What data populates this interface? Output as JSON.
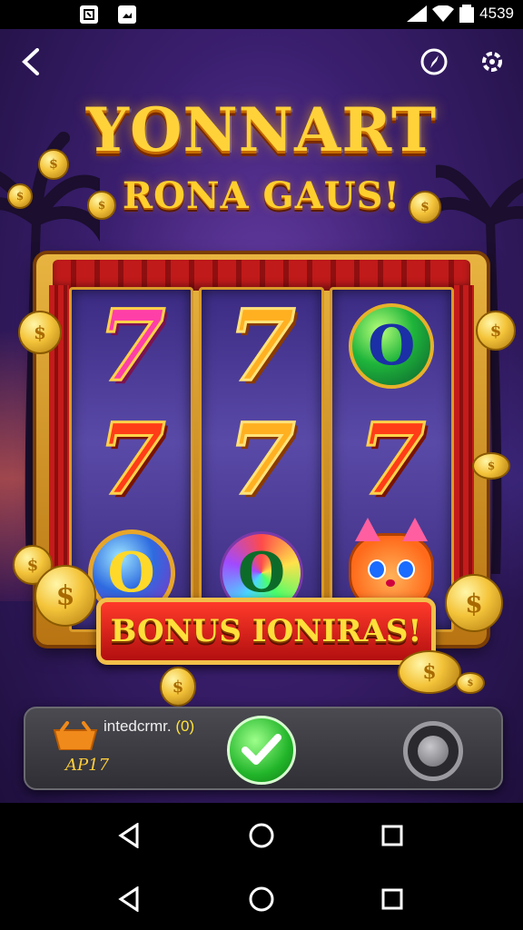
{
  "status_bar": {
    "time": "4539",
    "icons": [
      "notification-icon",
      "image-icon",
      "signal-icon",
      "wifi-icon",
      "battery-icon"
    ]
  },
  "header": {
    "title": "YONNART",
    "subtitle": "RONA GAUS!",
    "back_icon": "back-arrow-icon",
    "right_icons": [
      "compass-icon",
      "settings-icon"
    ]
  },
  "reels": [
    [
      "7",
      "7",
      "O"
    ],
    [
      "7",
      "7",
      "O"
    ],
    [
      "O",
      "7",
      "cat"
    ]
  ],
  "bonus_banner": {
    "label": "BONUS IONIRAS!"
  },
  "bottom_panel": {
    "label_prefix": "intedcrmr. ",
    "label_value": "(0)",
    "sublabel": "AP17",
    "confirm_icon": "check-icon",
    "spin_icon": "spin-knob-icon"
  },
  "system_nav": {
    "buttons": [
      "back-triangle-icon",
      "home-circle-icon",
      "recents-square-icon"
    ]
  },
  "colors": {
    "background": "#3b1f6f",
    "gold": "#ffd23a",
    "red": "#c01a1a",
    "panel": "#3a3a40",
    "confirm": "#22b52a"
  }
}
